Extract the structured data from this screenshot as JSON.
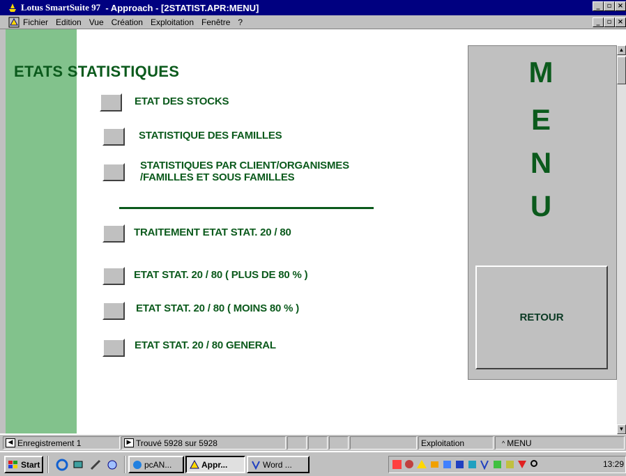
{
  "window": {
    "app_name": "Lotus SmartSuite 97",
    "title_rest": "  - Approach - [2STATIST.APR:MENU]"
  },
  "menubar": {
    "items": [
      "Fichier",
      "Edition",
      "Vue",
      "Création",
      "Exploitation",
      "Fenêtre",
      "?"
    ]
  },
  "form": {
    "heading": "ETATS STATISTIQUES",
    "buttons": [
      {
        "label": "ETAT DES STOCKS"
      },
      {
        "label": "STATISTIQUE DES FAMILLES"
      },
      {
        "label_line1": "STATISTIQUES PAR CLIENT/ORGANISMES",
        "label_line2": "/FAMILLES ET SOUS FAMILLES"
      },
      {
        "label": "TRAITEMENT ETAT STAT. 20 / 80"
      },
      {
        "label": "ETAT STAT. 20 / 80 ( PLUS DE 80 % )"
      },
      {
        "label": "ETAT STAT. 20 / 80 ( MOINS 80 % )"
      },
      {
        "label": "ETAT STAT. 20 / 80 GENERAL"
      }
    ],
    "menu_letters": [
      "M",
      "E",
      "N",
      "U"
    ],
    "retour_label": "RETOUR"
  },
  "statusbar": {
    "record": "Enregistrement 1",
    "found": "Trouvé 5928 sur 5928",
    "mode": "Exploitation",
    "view": "MENU"
  },
  "taskbar": {
    "start_label": "Start",
    "tasks": [
      "pcAN...",
      "Appr...",
      "Word ..."
    ],
    "active_task": "Appr...",
    "clock": "13:29"
  },
  "colors": {
    "title_bar": "#000080",
    "form_green_text": "#0b5a1c",
    "strip_green": "#82c28c",
    "panel_gray": "#c0c0c0"
  }
}
